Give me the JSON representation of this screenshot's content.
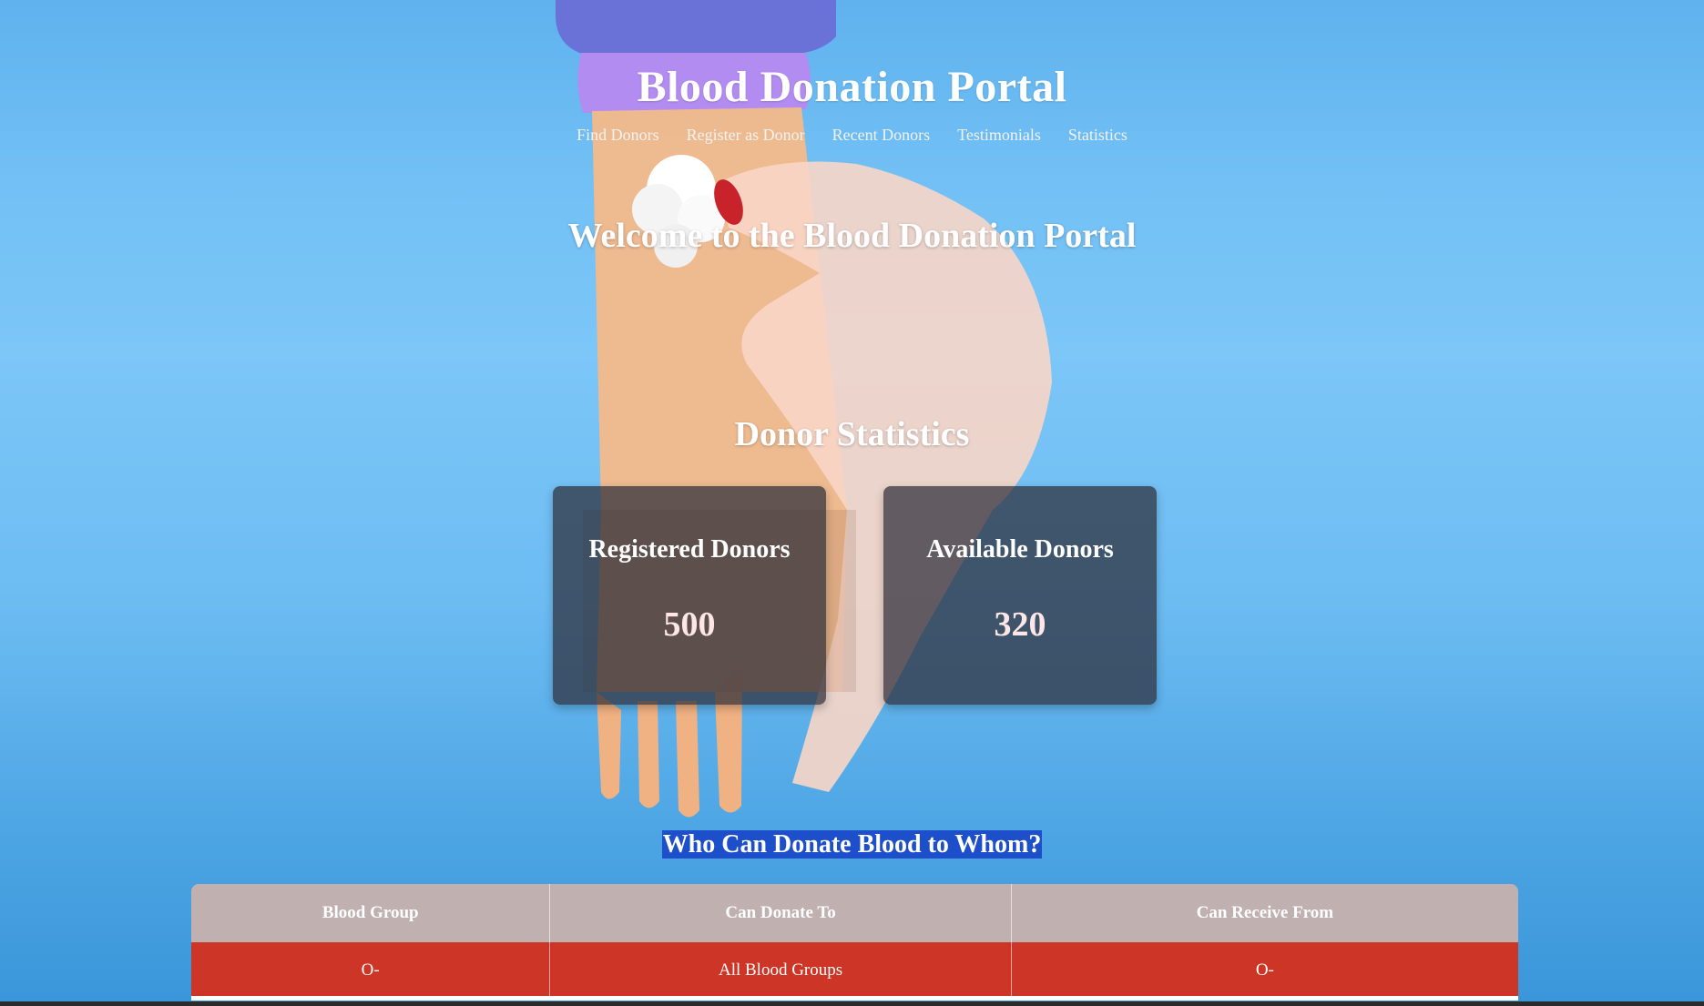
{
  "site": {
    "title": "Blood Donation Portal"
  },
  "nav": {
    "items": [
      {
        "label": "Find Donors"
      },
      {
        "label": "Register as Donor"
      },
      {
        "label": "Recent Donors"
      },
      {
        "label": "Testimonials"
      },
      {
        "label": "Statistics"
      }
    ]
  },
  "hero": {
    "welcome": "Welcome to the Blood Donation Portal"
  },
  "stats": {
    "heading": "Donor Statistics",
    "cards": [
      {
        "label": "Registered Donors",
        "value": "500"
      },
      {
        "label": "Available Donors",
        "value": "320"
      }
    ]
  },
  "compatibility": {
    "heading": "Who Can Donate Blood to Whom?",
    "columns": [
      "Blood Group",
      "Can Donate To",
      "Can Receive From"
    ],
    "rows": [
      [
        "O-",
        "All Blood Groups",
        "O-"
      ]
    ]
  },
  "colors": {
    "background": "#72c0f5",
    "card": "#2d2d37",
    "table_header": "#c0b0b0",
    "table_row": "#cd3526",
    "highlight": "#1c4fc9"
  }
}
